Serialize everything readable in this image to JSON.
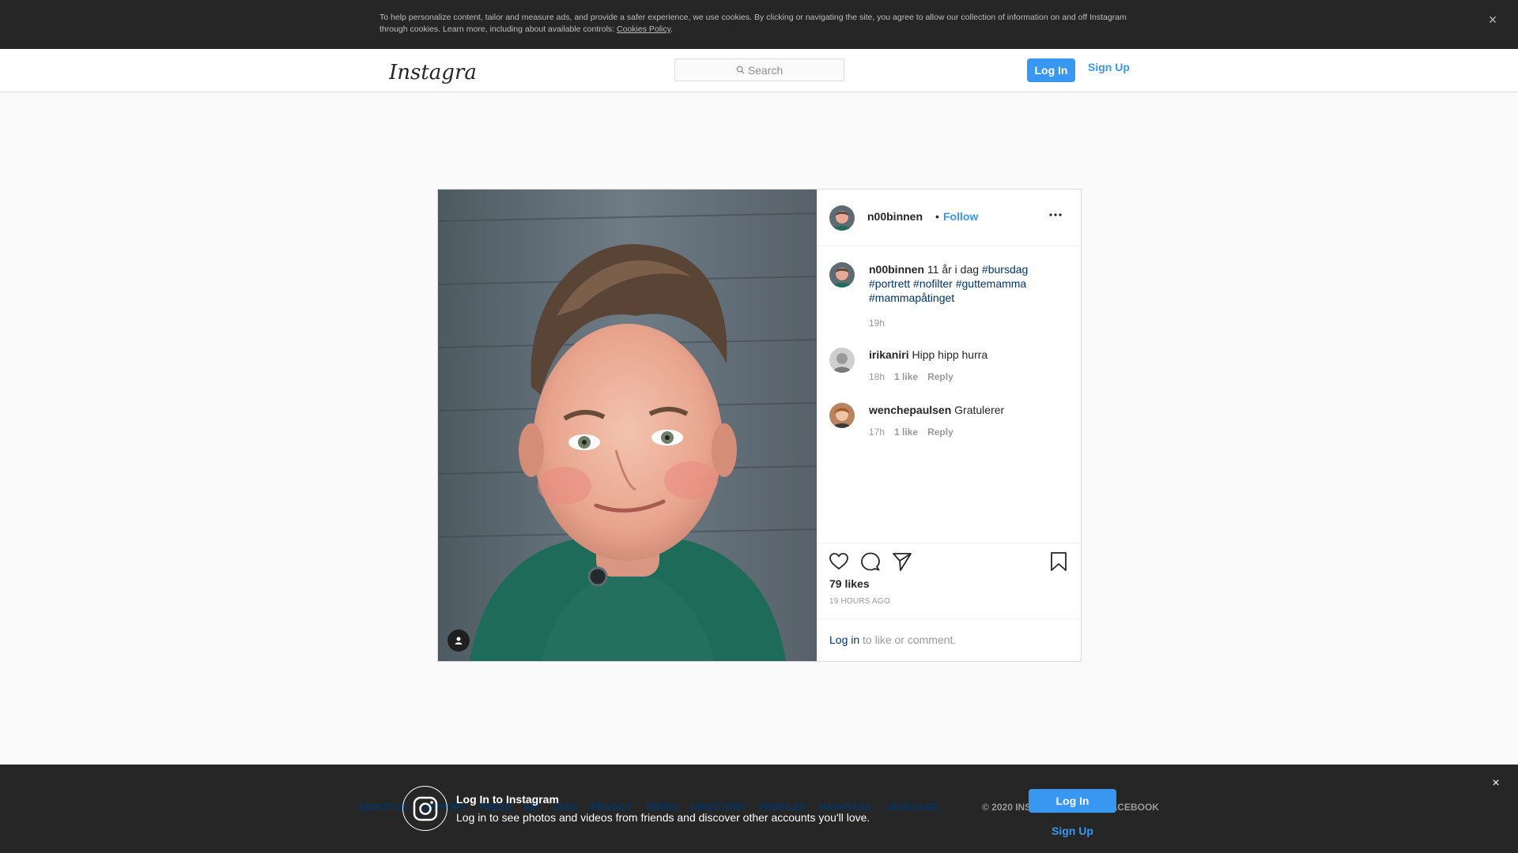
{
  "cookie_banner": {
    "text": "To help personalize content, tailor and measure ads, and provide a safer experience, we use cookies. By clicking or navigating the site, you agree to allow our collection of information on and off Instagram through cookies. Learn more, including about available controls: ",
    "policy_link": "Cookies Policy",
    "end": ".",
    "close_glyph": "×"
  },
  "nav": {
    "logo_text": "Instagram",
    "search_placeholder": "Search",
    "login_label": "Log In",
    "signup_label": "Sign Up"
  },
  "post": {
    "username": "n00binnen",
    "dot": "•",
    "follow_label": "Follow",
    "caption": {
      "username": "n00binnen",
      "text": "11 år i dag ",
      "tags": [
        "#bursdag",
        "#portrett",
        "#nofilter",
        "#guttemamma",
        "#mammapåtinget"
      ],
      "time": "19h"
    },
    "comments": [
      {
        "username": "irikaniri",
        "text": "Hipp hipp hurra",
        "time": "18h",
        "likes": "1 like",
        "reply": "Reply"
      },
      {
        "username": "wenchepaulsen",
        "text": "Gratulerer",
        "time": "17h",
        "likes": "1 like",
        "reply": "Reply"
      }
    ],
    "likes": "79 likes",
    "time_ago": "19 HOURS AGO",
    "login_link": "Log in",
    "login_rest": " to like or comment."
  },
  "footer": {
    "links": [
      "ABOUT US",
      "SUPPORT",
      "PRESS",
      "API",
      "JOBS",
      "PRIVACY",
      "TERMS",
      "DIRECTORY",
      "PROFILES",
      "HASHTAGS",
      "LANGUAGE"
    ],
    "copyright": "© 2020 INSTAGRAM FROM FACEBOOK"
  },
  "login_bar": {
    "title": "Log In to Instagram",
    "subtitle": "Log in to see photos and videos from friends and discover other accounts you'll love.",
    "login_label": "Log In",
    "signup_label": "Sign Up",
    "close_glyph": "×"
  },
  "colors": {
    "accent": "#3897f0",
    "hashtag": "#003569",
    "banner": "#262626"
  },
  "icons": [
    "close-icon",
    "search-icon",
    "more-icon",
    "heart-icon",
    "comment-icon",
    "share-icon",
    "bookmark-icon",
    "user-tag-icon",
    "instagram-glyph-icon"
  ]
}
